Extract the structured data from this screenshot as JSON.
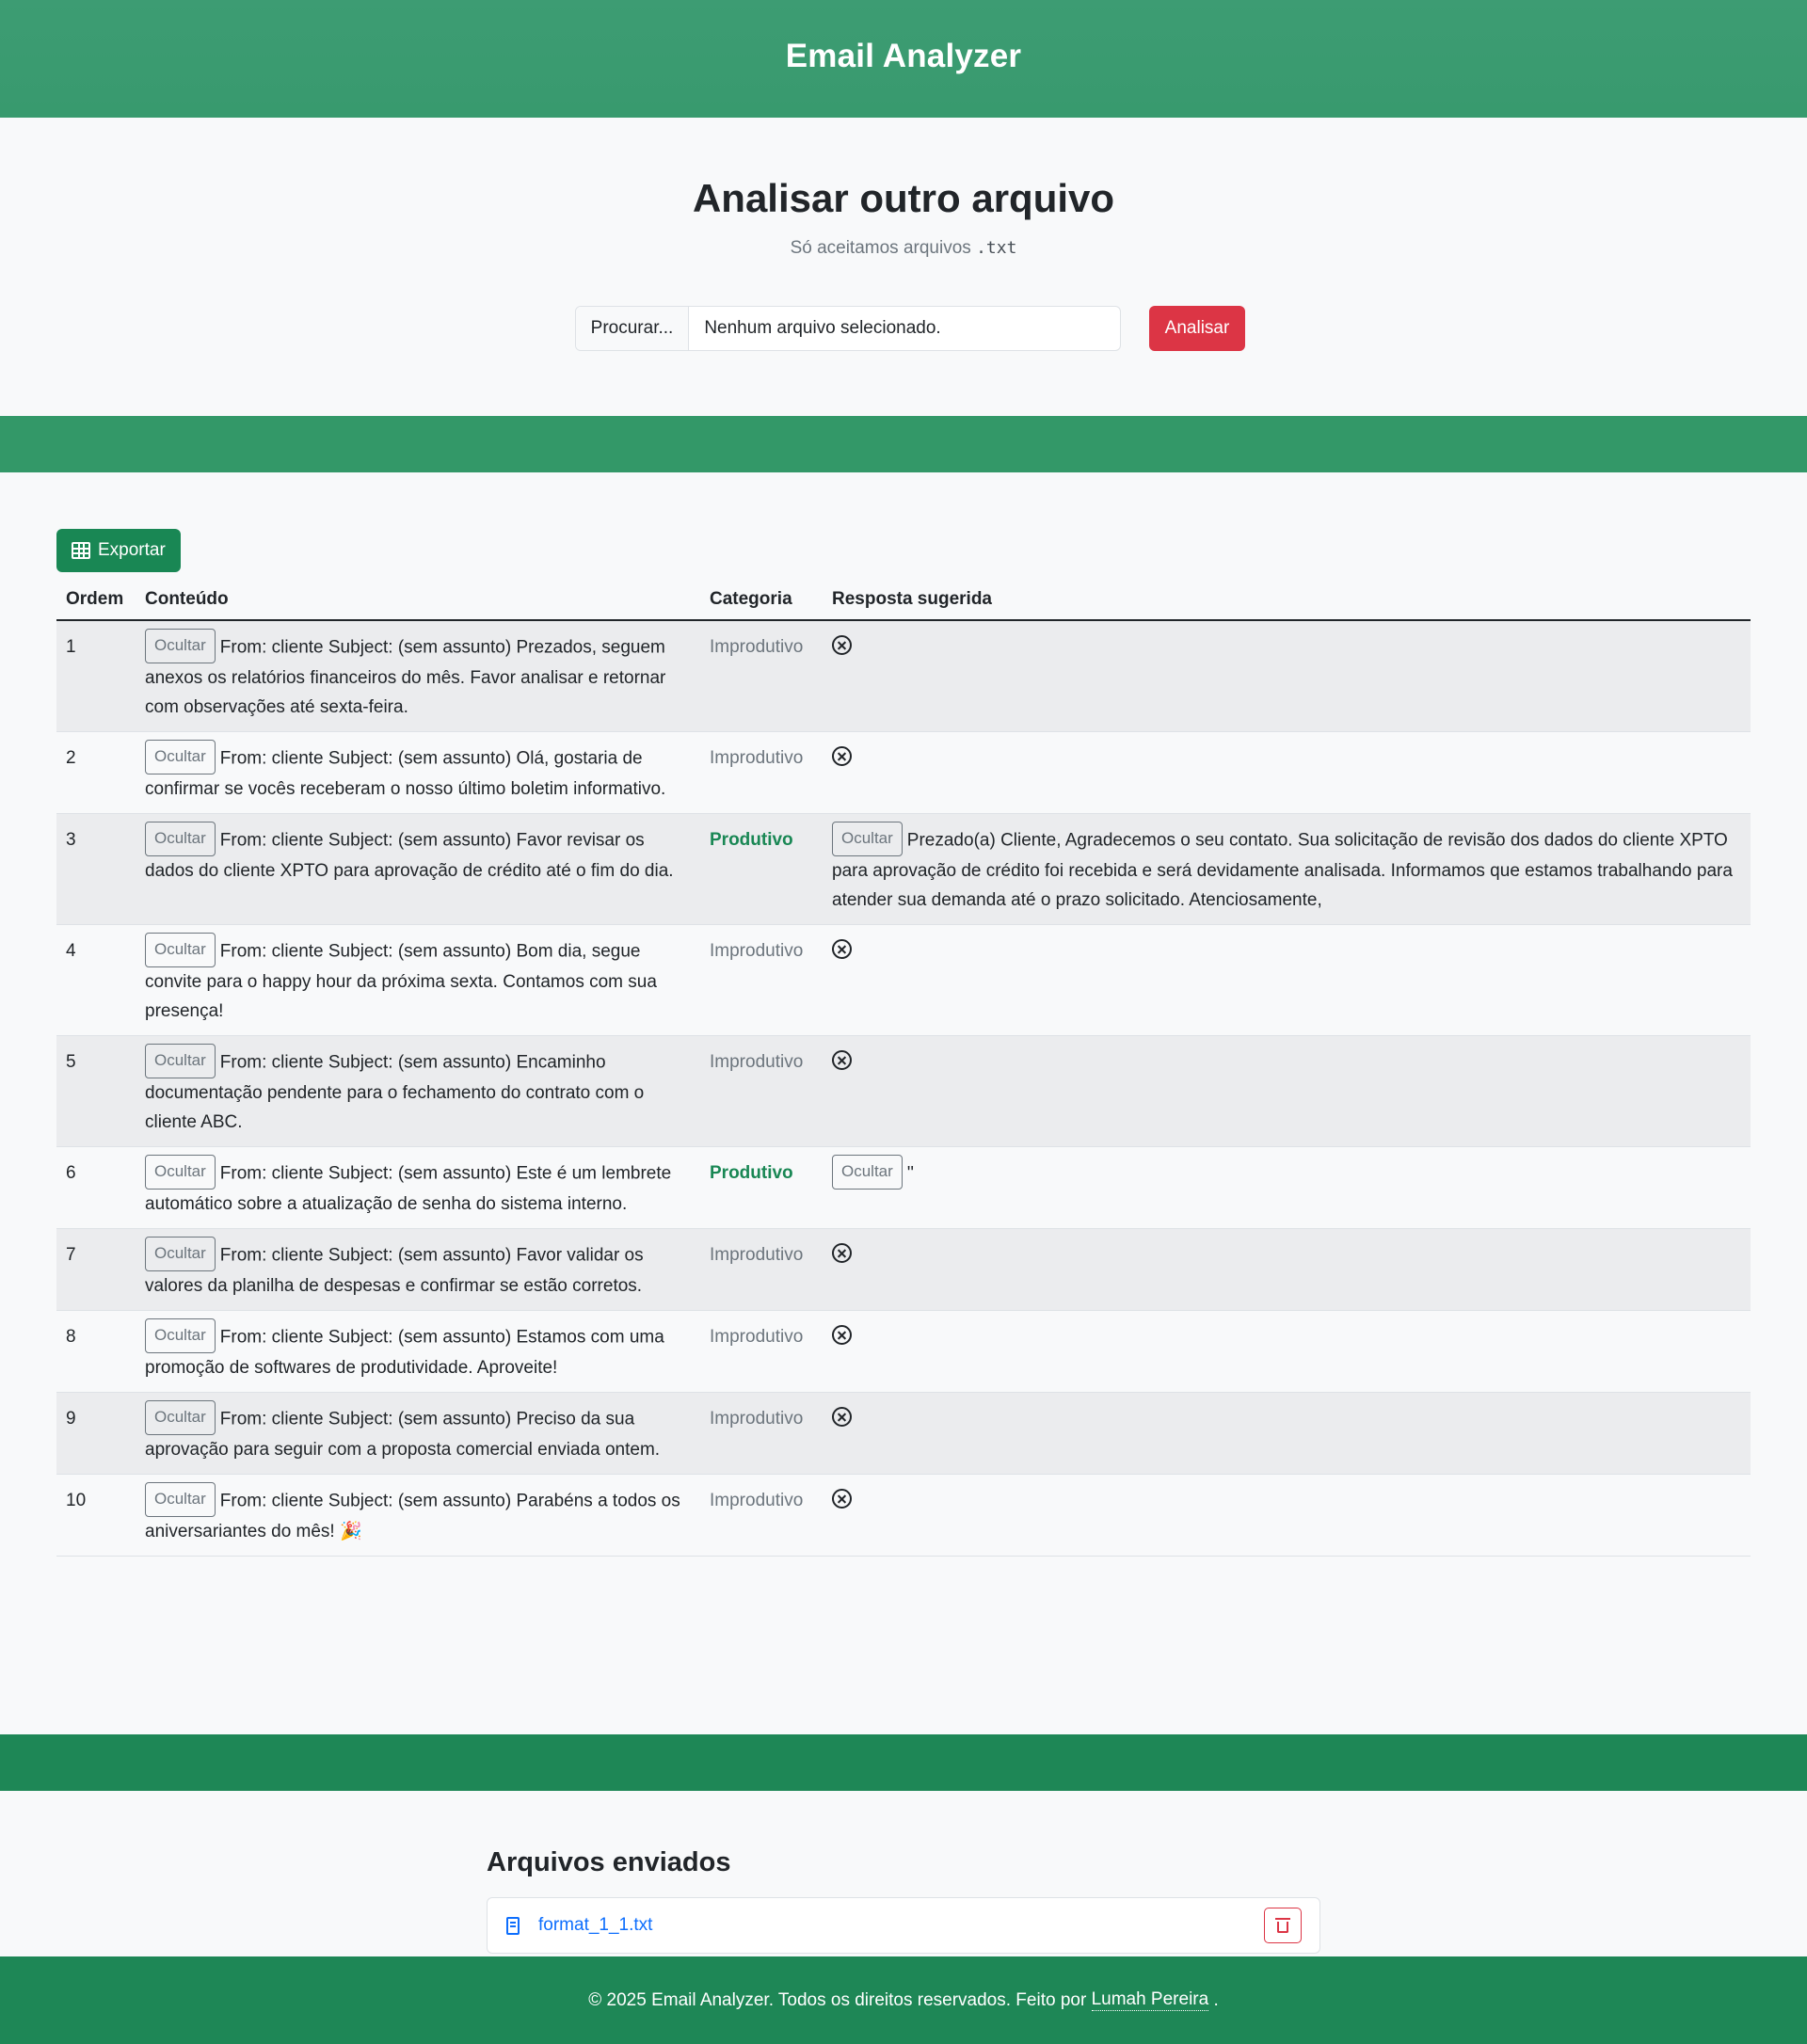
{
  "header": {
    "brand": "Email Analyzer"
  },
  "upload": {
    "title": "Analisar outro arquivo",
    "subtitle_prefix": "Só aceitamos arquivos",
    "subtitle_code": ".txt",
    "browse_label": "Procurar...",
    "file_status": "Nenhum arquivo selecionado.",
    "analyze_label": "Analisar"
  },
  "results": {
    "export_label": "Exportar",
    "columns": {
      "ordem": "Ordem",
      "conteudo": "Conteúdo",
      "categoria": "Categoria",
      "resposta": "Resposta sugerida"
    },
    "hide_label": "Ocultar",
    "rows": [
      {
        "ordem": "1",
        "content": "From: cliente Subject: (sem assunto) Prezados, seguem anexos os relatórios financeiros do mês. Favor analisar e retornar com observações até sexta-feira.",
        "category": "Improdutivo",
        "reply": null
      },
      {
        "ordem": "2",
        "content": "From: cliente Subject: (sem assunto) Olá, gostaria de confirmar se vocês receberam o nosso último boletim informativo.",
        "category": "Improdutivo",
        "reply": null
      },
      {
        "ordem": "3",
        "content": "From: cliente Subject: (sem assunto) Favor revisar os dados do cliente XPTO para aprovação de crédito até o fim do dia.",
        "category": "Produtivo",
        "reply": "Prezado(a) Cliente, Agradecemos o seu contato. Sua solicitação de revisão dos dados do cliente XPTO para aprovação de crédito foi recebida e será devidamente analisada. Informamos que estamos trabalhando para atender sua demanda até o prazo solicitado. Atenciosamente,"
      },
      {
        "ordem": "4",
        "content": "From: cliente Subject: (sem assunto) Bom dia, segue convite para o happy hour da próxima sexta. Contamos com sua presença!",
        "category": "Improdutivo",
        "reply": null
      },
      {
        "ordem": "5",
        "content": "From: cliente Subject: (sem assunto) Encaminho documentação pendente para o fechamento do contrato com o cliente ABC.",
        "category": "Improdutivo",
        "reply": null
      },
      {
        "ordem": "6",
        "content": "From: cliente Subject: (sem assunto) Este é um lembrete automático sobre a atualização de senha do sistema interno.",
        "category": "Produtivo",
        "reply": "''"
      },
      {
        "ordem": "7",
        "content": "From: cliente Subject: (sem assunto) Favor validar os valores da planilha de despesas e confirmar se estão corretos.",
        "category": "Improdutivo",
        "reply": null
      },
      {
        "ordem": "8",
        "content": "From: cliente Subject: (sem assunto) Estamos com uma promoção de softwares de produtividade. Aproveite!",
        "category": "Improdutivo",
        "reply": null
      },
      {
        "ordem": "9",
        "content": "From: cliente Subject: (sem assunto) Preciso da sua aprovação para seguir com a proposta comercial enviada ontem.",
        "category": "Improdutivo",
        "reply": null
      },
      {
        "ordem": "10",
        "content": "From: cliente Subject: (sem assunto) Parabéns a todos os aniversariantes do mês! 🎉",
        "category": "Improdutivo",
        "reply": null
      }
    ]
  },
  "uploads": {
    "title": "Arquivos enviados",
    "files": [
      {
        "name": "format_1_1.txt"
      }
    ]
  },
  "footer": {
    "text": "© 2025 Email Analyzer. Todos os direitos reservados. Feito por",
    "author": "Lumah Pereira",
    "end": "."
  },
  "colors": {
    "header_green": "#3d9c73",
    "band_green": "#339868",
    "footer_green": "#1e8756",
    "danger": "#dc3545",
    "success": "#198754",
    "link": "#0d6efd"
  }
}
